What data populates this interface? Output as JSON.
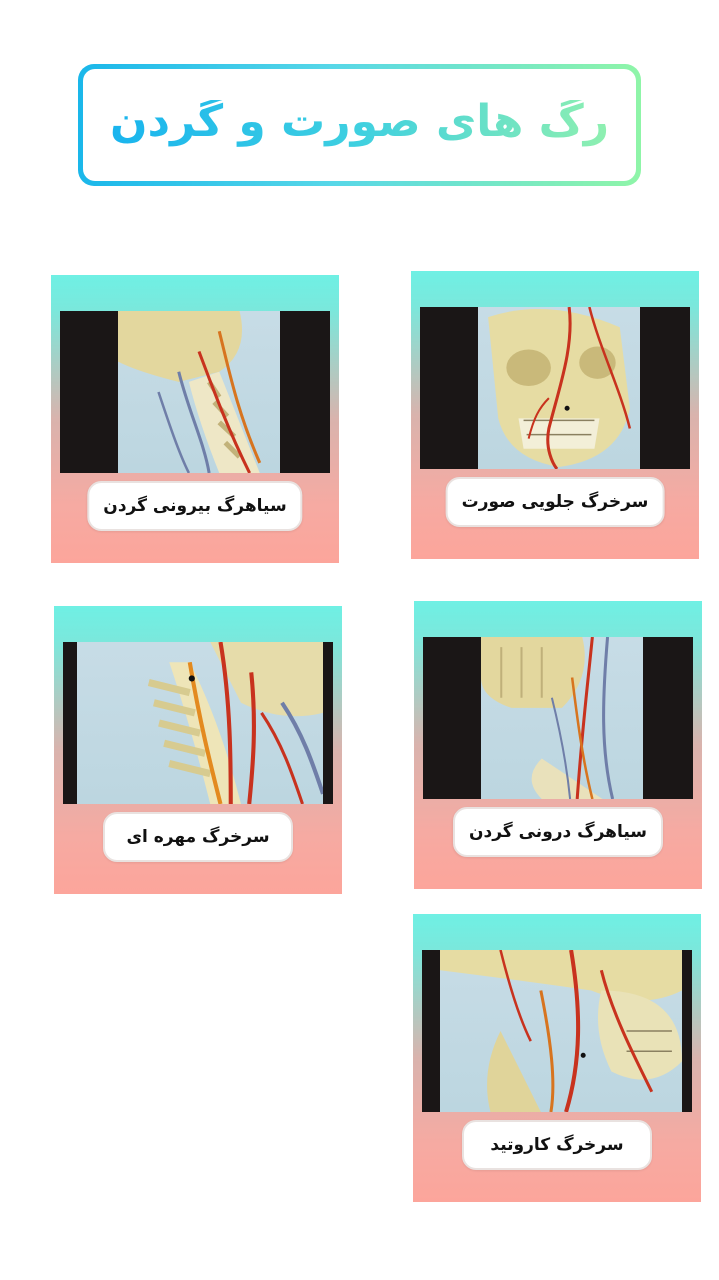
{
  "title": "رگ های صورت و گردن",
  "colors": {
    "accent_start": "#1ab7ea",
    "accent_end": "#8ff5a8",
    "card_top": "#6ff0e4",
    "card_bottom": "#fca59b"
  },
  "cards": [
    {
      "label": "سرخرگ جلویی صورت"
    },
    {
      "label": "سیاهرگ بیرونی گردن"
    },
    {
      "label": "سیاهرگ درونی گردن"
    },
    {
      "label": "سرخرگ مهره ای"
    },
    {
      "label": "سرخرگ کاروتید"
    }
  ]
}
